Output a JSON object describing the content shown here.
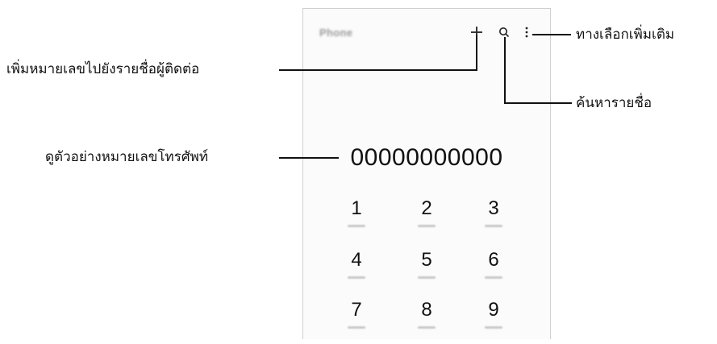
{
  "app": {
    "title": "Phone"
  },
  "toolbar": {
    "add_icon": "plus-icon",
    "search_icon": "search-icon",
    "more_icon": "more-vertical-icon"
  },
  "dialer": {
    "number": "00000000000",
    "keys": [
      "1",
      "2",
      "3",
      "4",
      "5",
      "6",
      "7",
      "8",
      "9"
    ]
  },
  "callouts": {
    "more_options": "ทางเลือกเพิ่มเติม",
    "add_to_contacts": "เพิ่มหมายเลขไปยังรายชื่อผู้ติดต่อ",
    "search_contacts": "ค้นหารายชื่อ",
    "preview_number": "ดูตัวอย่างหมายเลขโทรศัพท์"
  }
}
